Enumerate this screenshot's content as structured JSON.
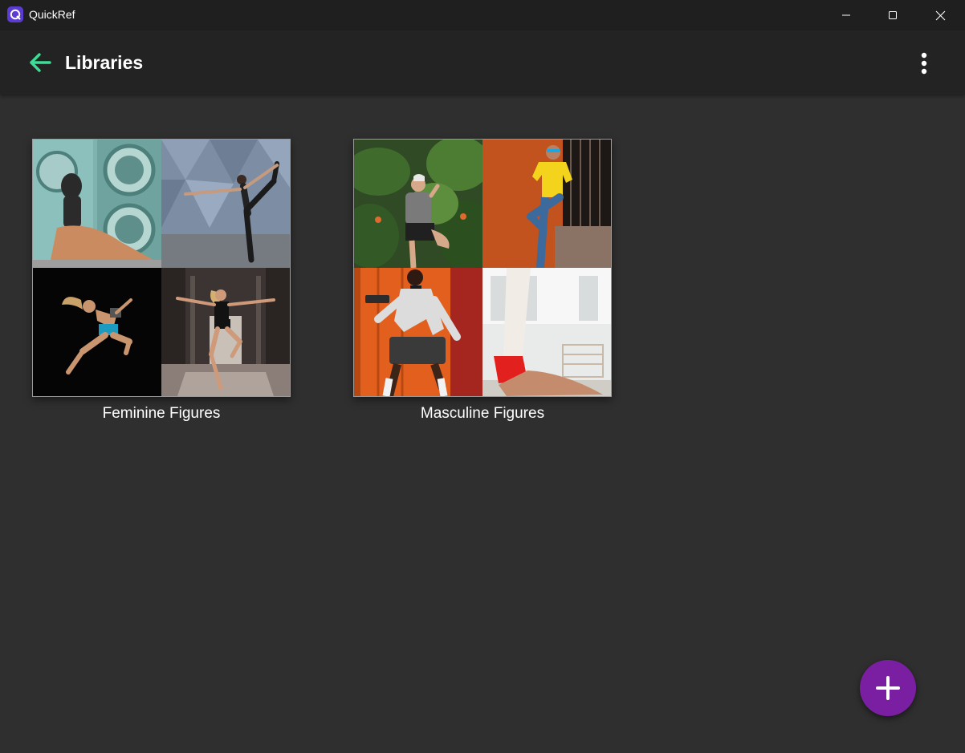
{
  "window": {
    "app_title": "QuickRef",
    "icons": {
      "app": "quickref-logo-icon",
      "minimize": "minimize-icon",
      "maximize": "maximize-icon",
      "close": "close-icon"
    }
  },
  "appbar": {
    "title": "Libraries",
    "back_icon": "arrow-left-icon",
    "menu_icon": "more-vertical-icon",
    "accent_color": "#3ddc97"
  },
  "libraries": [
    {
      "name": "Feminine Figures",
      "thumbnails": [
        "woman-sitting-in-laundromat-photo",
        "woman-dancer-standing-bow-pose-photo",
        "woman-dancer-leaping-on-black-photo",
        "woman-dancer-jumping-in-street-photo"
      ]
    },
    {
      "name": "Masculine Figures",
      "thumbnails": [
        "man-yoga-tree-pose-garden-photo",
        "man-yellow-shirt-leaning-wall-photo",
        "man-dancing-by-orange-door-photo",
        "man-shoulder-stand-gym-photo"
      ]
    }
  ],
  "fab": {
    "icon": "plus-icon",
    "color": "#7b1fa2"
  }
}
